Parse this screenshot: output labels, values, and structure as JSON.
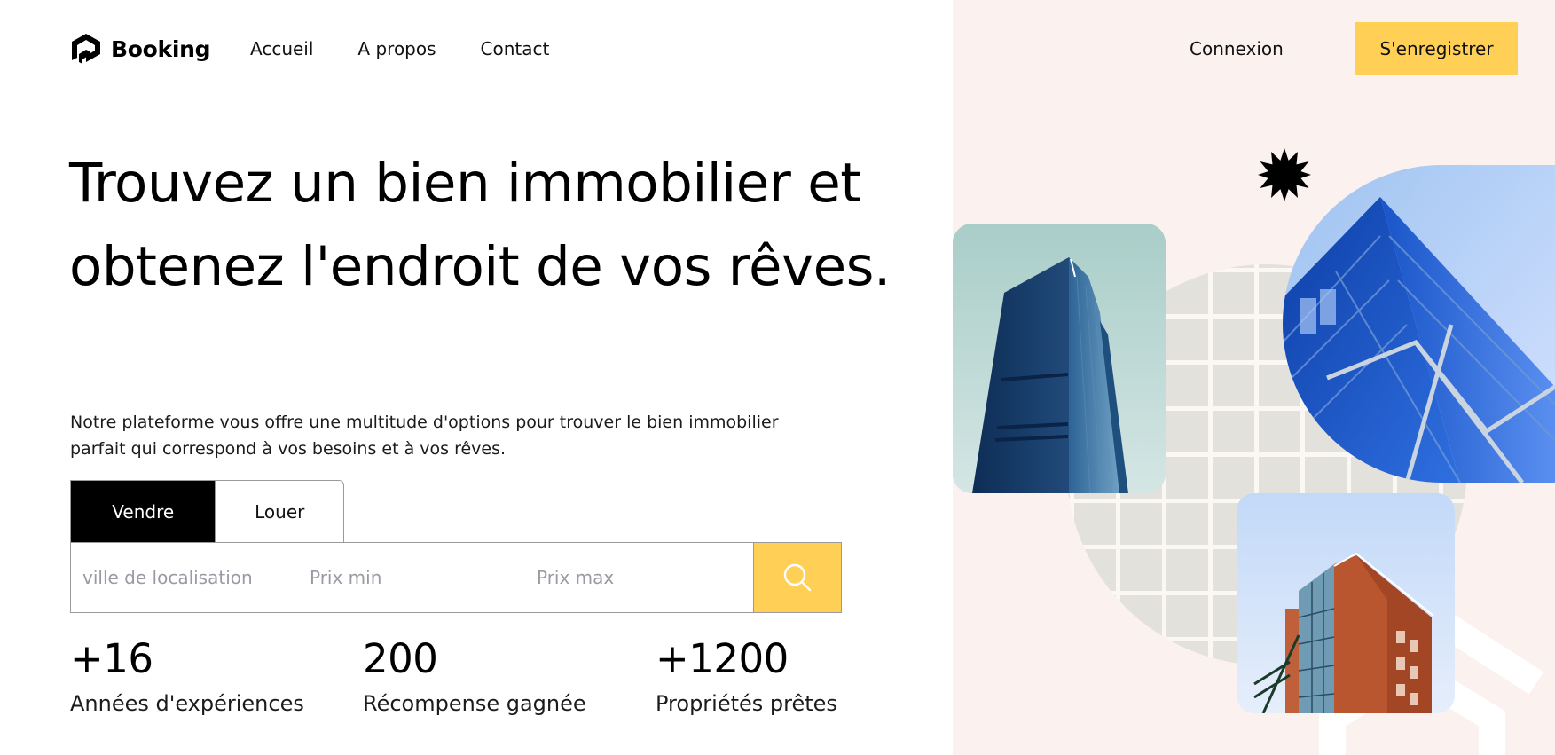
{
  "header": {
    "logo_text": "Booking",
    "nav": [
      {
        "label": "Accueil"
      },
      {
        "label": "A propos"
      },
      {
        "label": "Contact"
      }
    ],
    "login_label": "Connexion",
    "register_label": "S'enregistrer"
  },
  "hero": {
    "title": "Trouvez un bien immobilier et obtenez l'endroit de vos rêves.",
    "description": "Notre plateforme vous offre une multitude d'options pour trouver le bien immobilier parfait qui correspond à vos besoins et à vos rêves."
  },
  "search": {
    "tabs": [
      {
        "label": "Vendre",
        "active": true
      },
      {
        "label": "Louer",
        "active": false
      }
    ],
    "city_placeholder": "ville de localisation",
    "min_price_placeholder": "Prix min",
    "max_price_placeholder": "Prix max",
    "search_icon": "search-icon"
  },
  "stats": [
    {
      "value": "+16",
      "label": "Années d'expériences"
    },
    {
      "value": "200",
      "label": "Récompense gagnée"
    },
    {
      "value": "+1200",
      "label": "Propriétés prêtes"
    }
  ],
  "colors": {
    "accent": "#ffcf56",
    "panel_bg": "#fbf1ef",
    "text": "#000000"
  }
}
